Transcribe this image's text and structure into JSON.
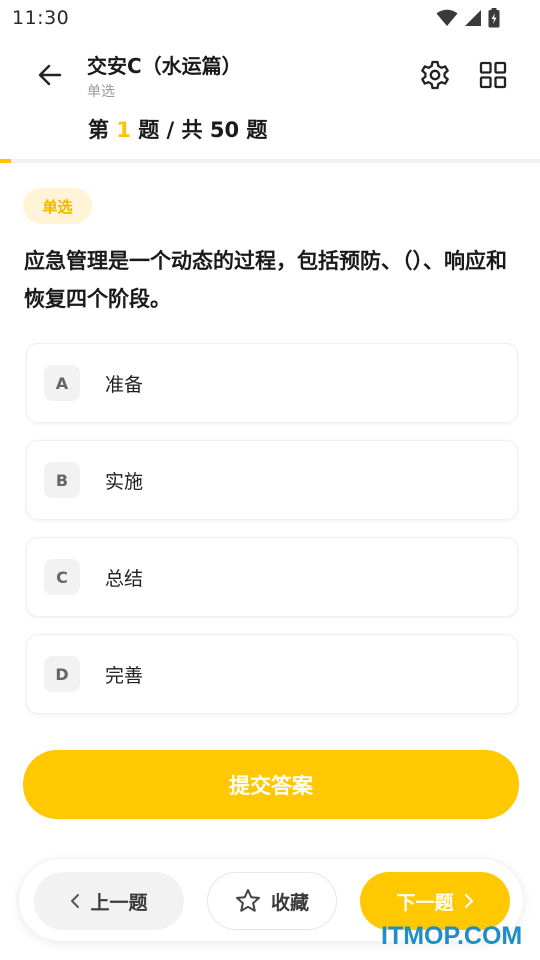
{
  "status_bar": {
    "time": "11:30",
    "icons": [
      "wifi-icon",
      "signal-icon",
      "battery-charging-icon"
    ]
  },
  "header": {
    "title": "交安C（水运篇）",
    "subtitle": "单选",
    "progress": {
      "prefix": "第 ",
      "current": "1",
      "suffix": " 题 / 共 50 题",
      "current_number": 1,
      "total_number": 50
    },
    "icons": [
      "back-arrow-icon",
      "gear-icon",
      "grid-icon"
    ]
  },
  "question": {
    "type_chip": "单选",
    "text": "应急管理是一个动态的过程，包括预防、（）、响应和恢复四个阶段。",
    "options": [
      {
        "letter": "A",
        "text": "准备"
      },
      {
        "letter": "B",
        "text": "实施"
      },
      {
        "letter": "C",
        "text": "总结"
      },
      {
        "letter": "D",
        "text": "完善"
      }
    ]
  },
  "submit_label": "提交答案",
  "bottom_nav": {
    "prev_label": "上一题",
    "favorite_label": "收藏",
    "next_label": "下一题",
    "icons": [
      "chevron-left-icon",
      "star-outline-icon",
      "chevron-right-icon"
    ]
  },
  "watermark": "ITMOP.COM",
  "colors": {
    "accent": "#ffc800",
    "chip_bg": "#fff5d6",
    "chip_text": "#f5b400",
    "watermark": "#1e8ec8"
  }
}
